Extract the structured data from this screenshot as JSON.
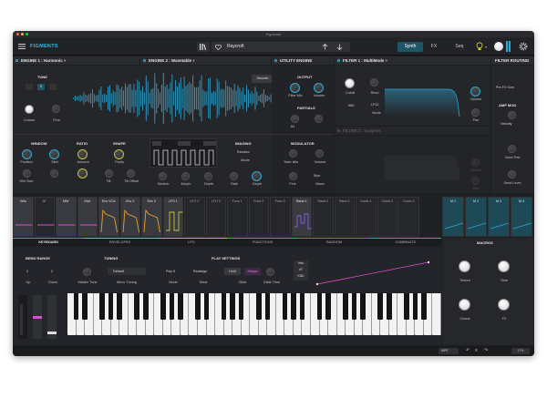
{
  "window": {
    "title": "Figments"
  },
  "toolbar": {
    "logo": "FIGMENTS",
    "preset_name": "Raycroft",
    "tabs": [
      "Synth",
      "FX",
      "Seq"
    ],
    "active_tab": "Synth"
  },
  "engine1": {
    "title": "ENGINE 1 : Harmonic",
    "tune": {
      "section": "TUNE",
      "coarse_label": "Coarse",
      "fine_label": "Fine"
    },
    "window": {
      "section": "WINDOW",
      "position_label": "Position",
      "skirt_label": "Skirt",
      "win_size_label": "Win Size"
    },
    "ratio": {
      "section": "RATIO",
      "amount_label": "Amount"
    },
    "shape": {
      "section": "SHAPE",
      "parity_label": "Parity",
      "tilt_label": "Tilt",
      "tilt_offset_label": "Tilt Offset"
    }
  },
  "engine2": {
    "title": "ENGINE 2 : Wavetable",
    "smooth_label": "Smooth",
    "section_label": "Section",
    "morph_label": "Morph",
    "depth_label": "Depth",
    "imaging": {
      "section": "IMAGING",
      "mode_value": "Random",
      "mode_label": "Mode",
      "rate_label": "Rate",
      "depth_label": "Depth"
    }
  },
  "utility": {
    "title": "UTILITY ENGINE",
    "output": {
      "section": "OUTPUT",
      "filter_mix_label": "Filter Mix",
      "volume_label": "Volume"
    },
    "partials": {
      "section": "PARTIALS",
      "value": "64"
    },
    "modulator": {
      "section": "MODULATOR",
      "tune_value": "Tune: Abs",
      "volume_label": "Volume",
      "fine_label": "Fine",
      "wave_label": "Wave",
      "wave_value": "Sine"
    }
  },
  "filter1": {
    "title": "FILTER 1 : MultiMode",
    "cutoff_label": "Cutoff",
    "reso_label": "Reso",
    "mode_value": "LP12",
    "mode_label": "Mode",
    "k2_value": "K60",
    "volume_label": "Volume",
    "pan_label": "Pan"
  },
  "filter2": {
    "title": "FILTER 2 : Surgeon",
    "volume_label": "Volume",
    "pan_label": "Pan"
  },
  "routing": {
    "title": "FILTER ROUTING",
    "value": "Pre-FX Sum",
    "amp_mod_title": "AMP MOD",
    "amp_mod_value": "Velocity",
    "voice_pan_label": "Voice Pan",
    "send_level_label": "Send Level"
  },
  "mod_sources": [
    {
      "label": "Velo"
    },
    {
      "label": "AT"
    },
    {
      "label": "MW"
    },
    {
      "label": "Kbd"
    },
    {
      "label": "Env VCA"
    },
    {
      "label": "Env 2"
    },
    {
      "label": "Env 3"
    },
    {
      "label": "LFO 1"
    },
    {
      "label": "LFO 2"
    },
    {
      "label": "LFO 3"
    },
    {
      "label": "Func 1"
    },
    {
      "label": "Func 2"
    },
    {
      "label": "Func 3"
    },
    {
      "label": "Rand 1"
    },
    {
      "label": "Rand 2"
    },
    {
      "label": "Rand 3"
    },
    {
      "label": "Comb 1"
    },
    {
      "label": "Comb 2"
    },
    {
      "label": "Comb 3"
    },
    {
      "label": "M 1"
    },
    {
      "label": "M 2"
    },
    {
      "label": "M 3"
    },
    {
      "label": "M 4"
    }
  ],
  "bottom_tabs": [
    "KEYBOARD",
    "ENVELOPES",
    "LFO",
    "FUNCTIONS",
    "RANDOM",
    "COMBINATE"
  ],
  "active_bottom_tab": "KEYBOARD",
  "keyboard": {
    "bend_range": {
      "section": "BEND RANGE",
      "up_value": "2",
      "up_label": "Up",
      "down_value": "2",
      "down_label": "Down"
    },
    "tuning": {
      "section": "TUNING",
      "master_tune_label": "Master Tune",
      "micro_value": "Default",
      "micro_label": "Micro Tuning"
    },
    "play_settings": {
      "section": "PLAY SETTINGS",
      "mode_value": "Poly 8",
      "mode_label": "Mode",
      "steal_value": "Reassign",
      "steal_label": "Steal",
      "glide_value": "Hold",
      "glide_label": "Glide",
      "always_value": "Always",
      "glide_time_label": "Glide Time"
    },
    "velo_curve": {
      "velo": "Velo",
      "at": "AT",
      "kbd": "KBD"
    }
  },
  "macros": {
    "title": "MACROS",
    "items": [
      {
        "label": "Timbre"
      },
      {
        "label": "Time"
      },
      {
        "label": "Chaos"
      },
      {
        "label": "FX"
      }
    ]
  },
  "statusbar": {
    "mpe": "MPE",
    "zoom": "17%"
  },
  "colors": {
    "accent": "#2fa8d4",
    "yellow": "#c9c23a",
    "magenta": "#d94fd0",
    "orange": "#e6a030",
    "purple": "#8a5fe0"
  }
}
